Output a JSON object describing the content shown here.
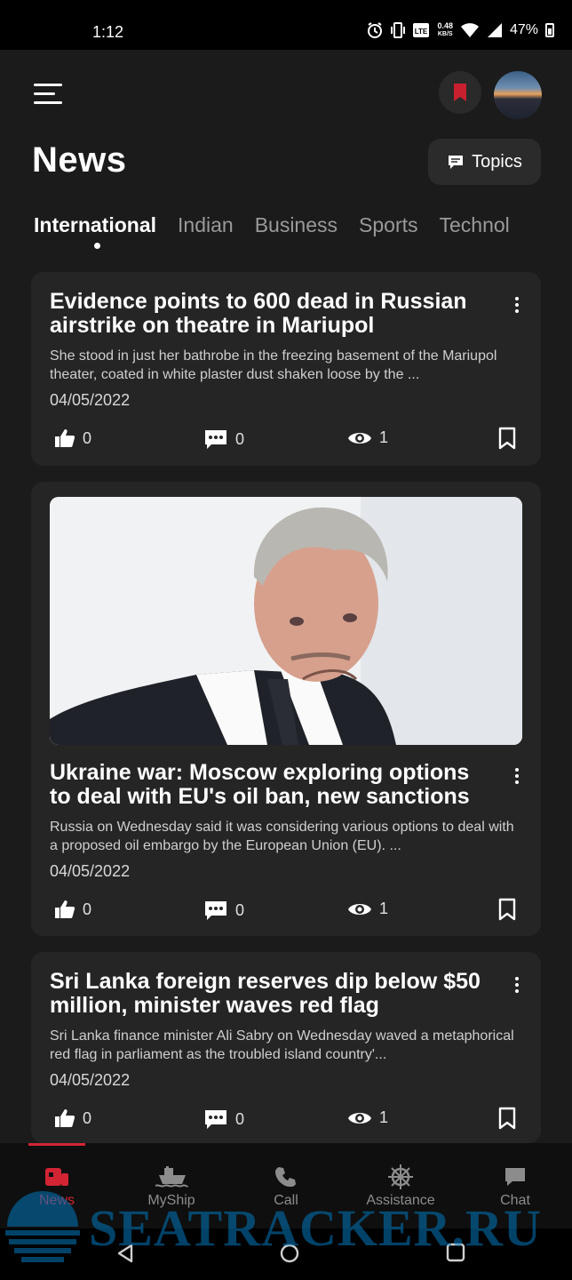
{
  "status_bar": {
    "time": "1:12",
    "network_speed": "0.48",
    "network_unit": "KB/S",
    "battery": "47%"
  },
  "header": {
    "title": "News",
    "topics_label": "Topics"
  },
  "tabs": [
    "International",
    "Indian",
    "Business",
    "Sports",
    "Technol"
  ],
  "active_tab": 0,
  "articles": [
    {
      "title": "Evidence points to 600 dead in Russian airstrike on theatre in Mariupol",
      "excerpt": "She stood in just her bathrobe in the freezing basement of the Mariupol theater, coated in white plaster dust shaken loose by the ...",
      "date": "04/05/2022",
      "likes": "0",
      "comments": "0",
      "views": "1",
      "has_image": false
    },
    {
      "title": "Ukraine war: Moscow exploring options to deal with EU's oil ban, new sanctions",
      "excerpt": "Russia on Wednesday said it was considering various options to deal with a proposed oil embargo by the European Union (EU). ...",
      "date": "04/05/2022",
      "likes": "0",
      "comments": "0",
      "views": "1",
      "has_image": true
    },
    {
      "title": "Sri Lanka foreign reserves dip below $50 million, minister waves red flag",
      "excerpt": "Sri Lanka finance minister Ali Sabry on Wednesday waved a metaphorical red flag in parliament as the troubled island country'...",
      "date": "04/05/2022",
      "likes": "0",
      "comments": "0",
      "views": "1",
      "has_image": false
    }
  ],
  "bottom_nav": [
    {
      "label": "News",
      "icon": "news-icon",
      "active": true
    },
    {
      "label": "MyShip",
      "icon": "ship-icon",
      "active": false
    },
    {
      "label": "Call",
      "icon": "phone-icon",
      "active": false
    },
    {
      "label": "Assistance",
      "icon": "helm-icon",
      "active": false
    },
    {
      "label": "Chat",
      "icon": "chat-icon",
      "active": false
    }
  ],
  "watermark": "SEATRACKER.RU",
  "colors": {
    "accent": "#d32434",
    "background": "#1b1b1b",
    "card": "#252525"
  }
}
